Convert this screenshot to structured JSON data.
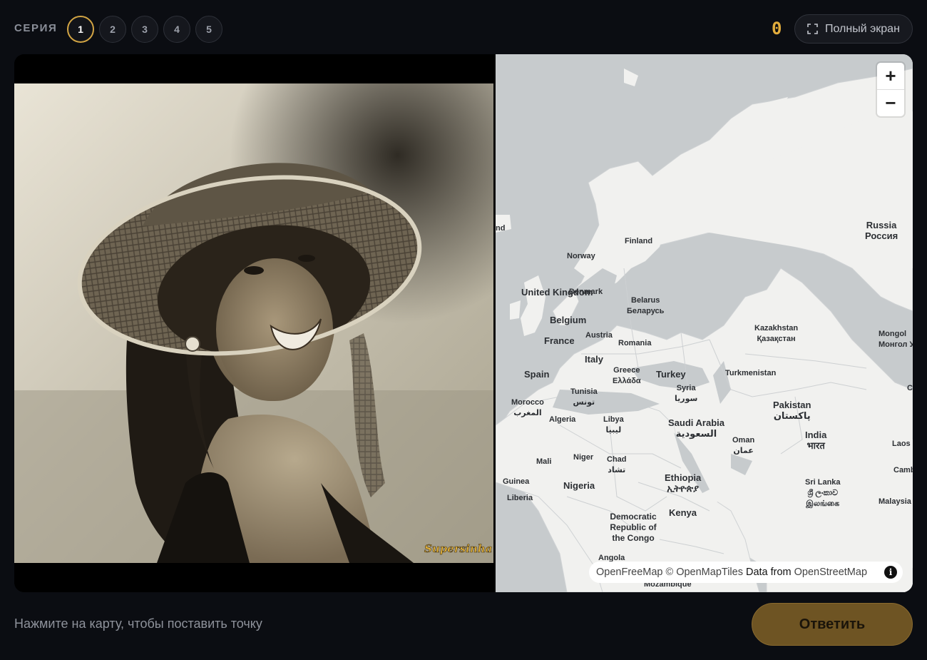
{
  "header": {
    "series_label": "СЕРИЯ",
    "rounds": [
      "1",
      "2",
      "3",
      "4",
      "5"
    ],
    "active_round": "1",
    "score": "0",
    "fullscreen_label": "Полный экран",
    "accent_color": "#d3a544"
  },
  "photo": {
    "watermark": "Supersinha"
  },
  "map": {
    "zoom_in": "+",
    "zoom_out": "−",
    "labels": {
      "iceland_partial": "nd",
      "finland": "Finland",
      "norway": "Norway",
      "united_kingdom": "United Kingdom",
      "denmark": "Denmark",
      "belarus": "Belarus",
      "belarus_native": "Беларусь",
      "belgium": "Belgium",
      "france": "France",
      "austria": "Austria",
      "romania": "Romania",
      "italy": "Italy",
      "spain": "Spain",
      "greece": "Greece",
      "greece_native": "Ελλάδα",
      "turkey": "Turkey",
      "turkmenistan": "Turkmenistan",
      "russia": "Russia",
      "russia_native": "Россия",
      "kazakhstan": "Kazakhstan",
      "kazakhstan_native": "Қазақстан",
      "mongolia": "Mongol",
      "mongolia_native": "Монгол У",
      "tunisia": "Tunisia",
      "tunisia_native": "تونس",
      "morocco": "Morocco",
      "morocco_native": "المغرب",
      "algeria": "Algeria",
      "libya": "Libya",
      "libya_native": "ليبيا",
      "syria": "Syria",
      "syria_native": "سوريا",
      "saudi_arabia": "Saudi Arabia",
      "saudi_arabia_native": "السعودية",
      "pakistan": "Pakistan",
      "pakistan_native": "پاکستان",
      "oman": "Oman",
      "oman_native": "عمان",
      "india": "India",
      "india_native": "भारत",
      "mali": "Mali",
      "niger": "Niger",
      "chad": "Chad",
      "chad_native": "تشاد",
      "guinea": "Guinea",
      "liberia": "Liberia",
      "nigeria": "Nigeria",
      "ethiopia": "Ethiopia",
      "ethiopia_native": "ኢትዮጵያ",
      "sri_lanka": "Sri Lanka",
      "sri_lanka_native1": "ශ්‍රී ලංකාව",
      "sri_lanka_native2": "இலங்கை",
      "laos": "Laos",
      "cambodia": "Cambo",
      "malaysia": "Malaysia",
      "china_partial": "C",
      "drc": "Democratic Republic of the Congo",
      "kenya": "Kenya",
      "angola": "Angola",
      "mozambique": "Mozambique"
    },
    "attribution": {
      "part1": "OpenFreeMap",
      "part2": "© OpenMapTiles",
      "part3": "Data from",
      "part4": "OpenStreetMap"
    }
  },
  "footer": {
    "hint": "Нажмите на карту, чтобы поставить точку",
    "answer_label": "Ответить"
  }
}
